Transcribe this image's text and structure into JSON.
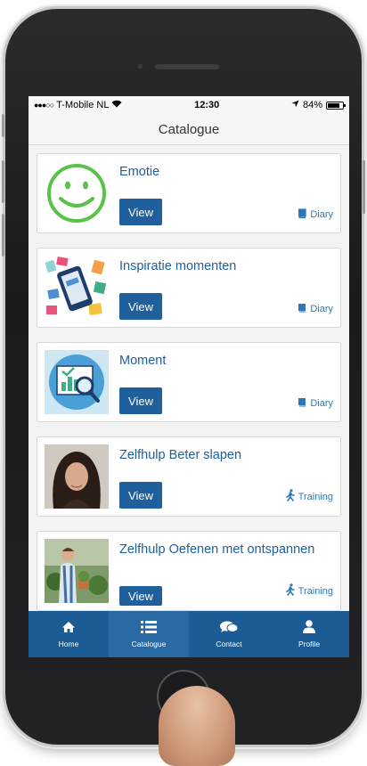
{
  "status_bar": {
    "signal": "●●●○○",
    "carrier": "T-Mobile NL",
    "time": "12:30",
    "battery": "84%",
    "battery_level": 0.84
  },
  "header": {
    "title": "Catalogue"
  },
  "items": [
    {
      "title": "Emotie",
      "button": "View",
      "type": "Diary",
      "type_icon": "book-icon",
      "thumb": "smiley-face"
    },
    {
      "title": "Inspiratie momenten",
      "button": "View",
      "type": "Diary",
      "type_icon": "book-icon",
      "thumb": "phone-cards-illustration"
    },
    {
      "title": "Moment",
      "button": "View",
      "type": "Diary",
      "type_icon": "book-icon",
      "thumb": "chart-magnifier-illustration"
    },
    {
      "title": "Zelfhulp Beter slapen",
      "button": "View",
      "type": "Training",
      "type_icon": "walking-person-icon",
      "thumb": "woman-photo"
    },
    {
      "title": "Zelfhulp Oefenen met ontspannen",
      "button": "View",
      "type": "Training",
      "type_icon": "walking-person-icon",
      "thumb": "gardening-photo"
    }
  ],
  "tabs": [
    {
      "label": "Home",
      "icon": "home-icon",
      "active": false
    },
    {
      "label": "Catalogue",
      "icon": "list-icon",
      "active": true
    },
    {
      "label": "Contact",
      "icon": "chat-icon",
      "active": false
    },
    {
      "label": "Profile",
      "icon": "user-icon",
      "active": false
    }
  ],
  "colors": {
    "accent": "#1f5f9c",
    "tab_bar": "#1c5c95",
    "smiley": "#5cc14a"
  }
}
